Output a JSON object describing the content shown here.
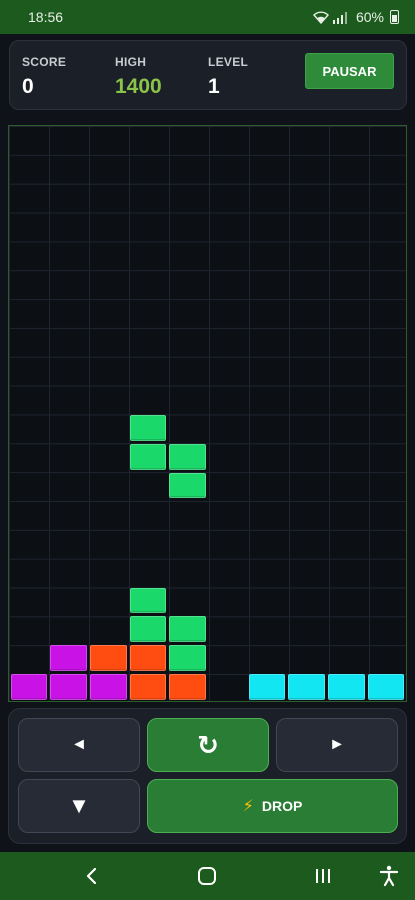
{
  "status_bar": {
    "time": "18:56",
    "battery": "60%",
    "icons": [
      "wifi-icon",
      "signal-icon",
      "battery-icon"
    ]
  },
  "stats": {
    "score_label": "SCORE",
    "score_value": "0",
    "high_label": "HIGH",
    "high_value": "1400",
    "level_label": "LEVEL",
    "level_value": "1"
  },
  "pause_button": {
    "label": "PAUSAR"
  },
  "board": {
    "columns": 10,
    "rows": 20,
    "colors": {
      "green": "#1bd86a",
      "magenta": "#c912e6",
      "orange": "#ff4d12",
      "cyan": "#12e6f2"
    },
    "active_piece": {
      "shape": "S",
      "color": "green",
      "cells": [
        [
          3,
          10
        ],
        [
          3,
          11
        ],
        [
          4,
          11
        ],
        [
          4,
          12
        ]
      ]
    },
    "locked_cells": [
      {
        "col": 3,
        "row": 16,
        "color": "green"
      },
      {
        "col": 3,
        "row": 17,
        "color": "green"
      },
      {
        "col": 4,
        "row": 17,
        "color": "green"
      },
      {
        "col": 4,
        "row": 18,
        "color": "green"
      },
      {
        "col": 1,
        "row": 18,
        "color": "magenta"
      },
      {
        "col": 2,
        "row": 18,
        "color": "orange"
      },
      {
        "col": 3,
        "row": 18,
        "color": "orange"
      },
      {
        "col": 0,
        "row": 19,
        "color": "magenta"
      },
      {
        "col": 1,
        "row": 19,
        "color": "magenta"
      },
      {
        "col": 2,
        "row": 19,
        "color": "magenta"
      },
      {
        "col": 3,
        "row": 19,
        "color": "orange"
      },
      {
        "col": 4,
        "row": 19,
        "color": "orange"
      },
      {
        "col": 6,
        "row": 19,
        "color": "cyan"
      },
      {
        "col": 7,
        "row": 19,
        "color": "cyan"
      },
      {
        "col": 8,
        "row": 19,
        "color": "cyan"
      },
      {
        "col": 9,
        "row": 19,
        "color": "cyan"
      }
    ]
  },
  "controls": {
    "left_icon": "◄",
    "rotate_icon": "↻",
    "right_icon": "►",
    "down_icon": "▼",
    "drop_icon": "⚡",
    "drop_label": "DROP"
  },
  "nav_bar": {
    "back_icon": "back-icon",
    "home_icon": "home-icon",
    "recents_icon": "recents-icon",
    "accessibility_icon": "accessibility-icon"
  }
}
